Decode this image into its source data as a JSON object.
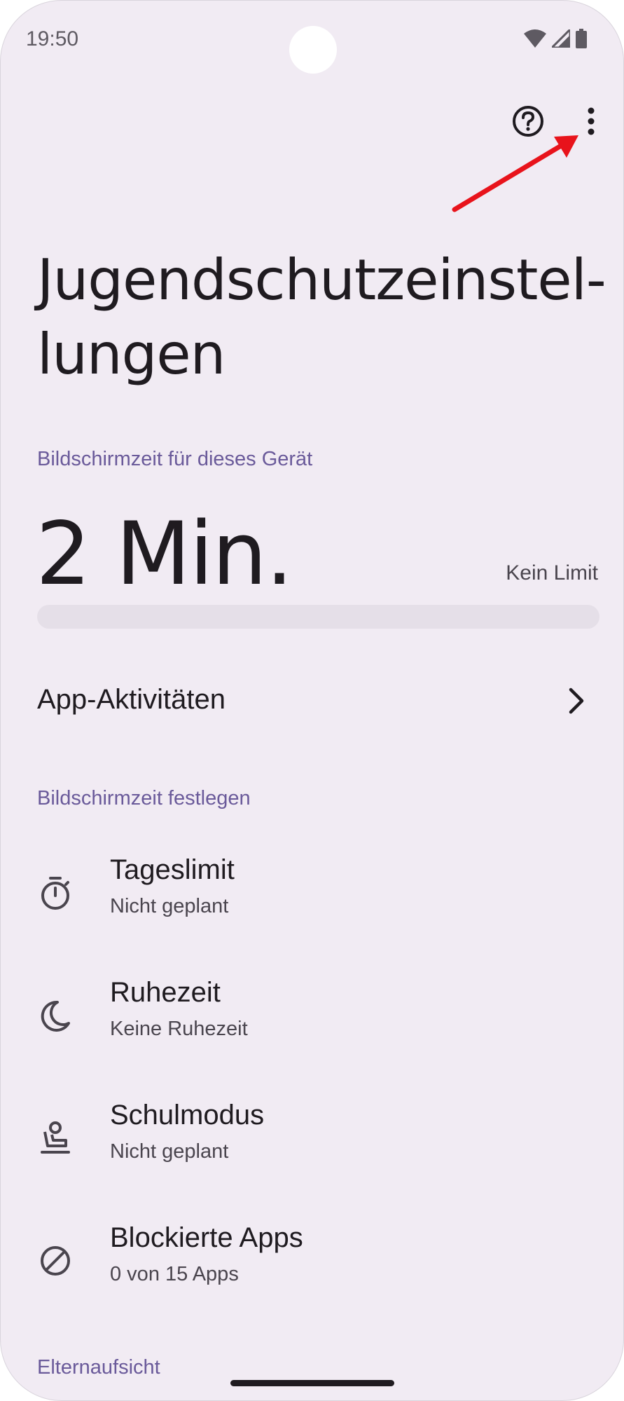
{
  "status_bar": {
    "time": "19:50"
  },
  "toolbar": {
    "help_icon": "help-circle-icon",
    "more_icon": "more-vert-icon"
  },
  "page": {
    "title": "Jugendschutzeinstel-\nlungen"
  },
  "screen_time": {
    "section_title": "Bildschirmzeit für dieses Gerät",
    "value": "2 Min.",
    "limit_label": "Kein Limit",
    "progress_fraction": 0
  },
  "app_activity": {
    "label": "App-Aktivitäten"
  },
  "set_screen_time": {
    "section_title": "Bildschirmzeit festlegen",
    "items": [
      {
        "title": "Tageslimit",
        "subtitle": "Nicht geplant",
        "icon": "timer-icon"
      },
      {
        "title": "Ruhezeit",
        "subtitle": "Keine Ruhezeit",
        "icon": "moon-icon"
      },
      {
        "title": "Schulmodus",
        "subtitle": "Nicht geplant",
        "icon": "school-desk-icon"
      },
      {
        "title": "Blockierte Apps",
        "subtitle": "0 von 15 Apps",
        "icon": "block-icon"
      }
    ]
  },
  "parental": {
    "section_title": "Elternaufsicht"
  },
  "colors": {
    "accent": "#6a5a9a",
    "background": "#f1ebf3",
    "annotation_arrow": "#e8131b"
  }
}
